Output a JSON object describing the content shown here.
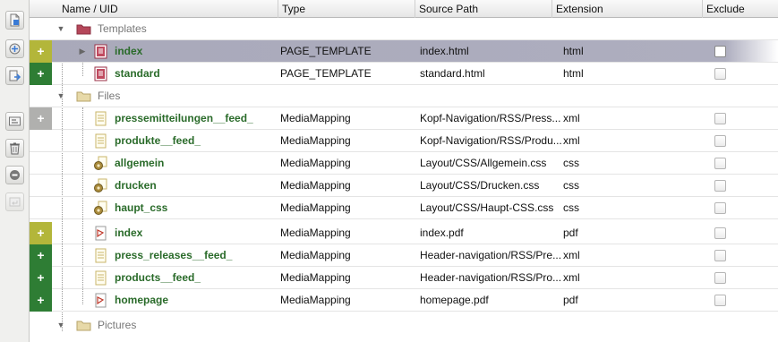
{
  "columns": {
    "name": "Name / UID",
    "type": "Type",
    "source_path": "Source Path",
    "extension": "Extension",
    "exclude": "Exclude"
  },
  "toolbar": [
    {
      "name": "new-icon",
      "enabled": true
    },
    {
      "name": "import-icon",
      "enabled": true
    },
    {
      "name": "export-icon",
      "enabled": true
    },
    {
      "name": "rename-icon",
      "enabled": true
    },
    {
      "name": "delete-icon",
      "enabled": true
    },
    {
      "name": "remove-icon",
      "enabled": true
    },
    {
      "name": "revert-icon",
      "enabled": false
    }
  ],
  "groups": {
    "templates": "Templates",
    "files": "Files",
    "pictures": "Pictures"
  },
  "rows": {
    "index_tpl": {
      "name": "index",
      "type": "PAGE_TEMPLATE",
      "path": "index.html",
      "ext": "html"
    },
    "standard": {
      "name": "standard",
      "type": "PAGE_TEMPLATE",
      "path": "standard.html",
      "ext": "html"
    },
    "presse": {
      "name": "pressemitteilungen__feed_",
      "type": "MediaMapping",
      "path": "Kopf-Navigation/RSS/Press...",
      "ext": "xml"
    },
    "produkte": {
      "name": "produkte__feed_",
      "type": "MediaMapping",
      "path": "Kopf-Navigation/RSS/Produ...",
      "ext": "xml"
    },
    "allgemein": {
      "name": "allgemein",
      "type": "MediaMapping",
      "path": "Layout/CSS/Allgemein.css",
      "ext": "css"
    },
    "drucken": {
      "name": "drucken",
      "type": "MediaMapping",
      "path": "Layout/CSS/Drucken.css",
      "ext": "css"
    },
    "haupt": {
      "name": "haupt_css",
      "type": "MediaMapping",
      "path": "Layout/CSS/Haupt-CSS.css",
      "ext": "css"
    },
    "index_pdf": {
      "name": "index",
      "type": "MediaMapping",
      "path": "index.pdf",
      "ext": "pdf"
    },
    "press_rel": {
      "name": "press_releases__feed_",
      "type": "MediaMapping",
      "path": "Header-navigation/RSS/Pre...",
      "ext": "xml"
    },
    "products": {
      "name": "products__feed_",
      "type": "MediaMapping",
      "path": "Header-navigation/RSS/Pro...",
      "ext": "xml"
    },
    "homepage": {
      "name": "homepage",
      "type": "MediaMapping",
      "path": "homepage.pdf",
      "ext": "pdf"
    }
  },
  "exclude_checked": false,
  "colors": {
    "gutter_yellow": "#b3b63a",
    "gutter_green": "#2e7d34",
    "gutter_gray": "#b0b0ae",
    "selection": "#a9a9ba",
    "name_text": "#2a6b2a"
  }
}
